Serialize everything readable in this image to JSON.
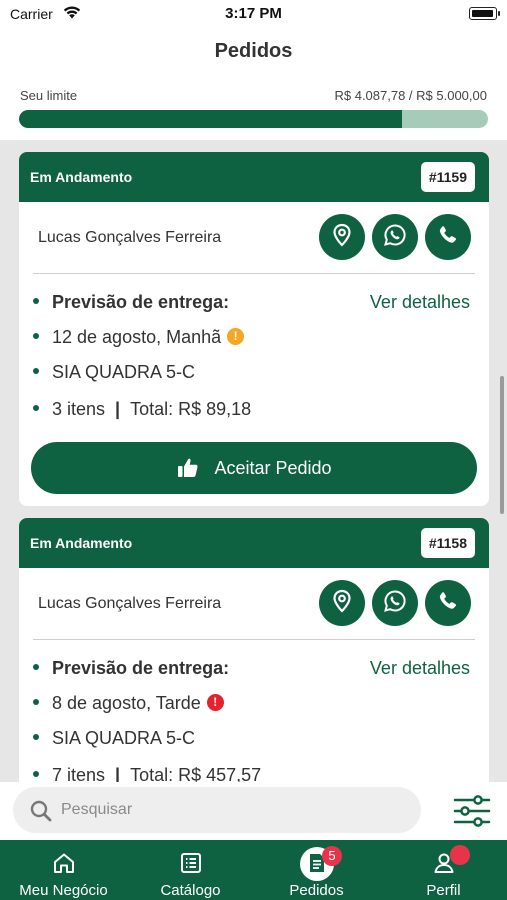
{
  "status_bar": {
    "carrier": "Carrier",
    "time": "3:17 PM"
  },
  "header": {
    "title": "Pedidos"
  },
  "limit": {
    "label": "Seu limite",
    "value": "R$ 4.087,78 / R$ 5.000,00",
    "progress_fraction": 0.8176
  },
  "orders": [
    {
      "status": "Em Andamento",
      "id": "#1159",
      "customer": "Lucas Gonçalves Ferreira",
      "delivery_label": "Previsão de entrega:",
      "details_link": "Ver detalhes",
      "date": "12 de agosto, Manhã",
      "warning_icon": "!",
      "warning_color": "#f5a623",
      "address": "SIA QUADRA 5-C",
      "items": "3 itens",
      "total": "Total: R$ 89,18",
      "accept_label": "Aceitar Pedido"
    },
    {
      "status": "Em Andamento",
      "id": "#1158",
      "customer": "Lucas Gonçalves Ferreira",
      "delivery_label": "Previsão de entrega:",
      "details_link": "Ver detalhes",
      "date": "8 de agosto, Tarde",
      "warning_icon": "!",
      "warning_color": "#e5232e",
      "address": "SIA QUADRA 5-C",
      "items": "7 itens",
      "total": "Total: R$ 457,57"
    }
  ],
  "search": {
    "placeholder": "Pesquisar"
  },
  "tabs": [
    {
      "label": "Meu Negócio",
      "icon": "home-icon"
    },
    {
      "label": "Catálogo",
      "icon": "catalog-icon"
    },
    {
      "label": "Pedidos",
      "icon": "orders-icon",
      "badge": "5",
      "active": true
    },
    {
      "label": "Perfil",
      "icon": "profile-icon"
    }
  ],
  "colors": {
    "primary": "#0e6241",
    "track": "#a7cbb9",
    "badge": "#e8344a"
  }
}
